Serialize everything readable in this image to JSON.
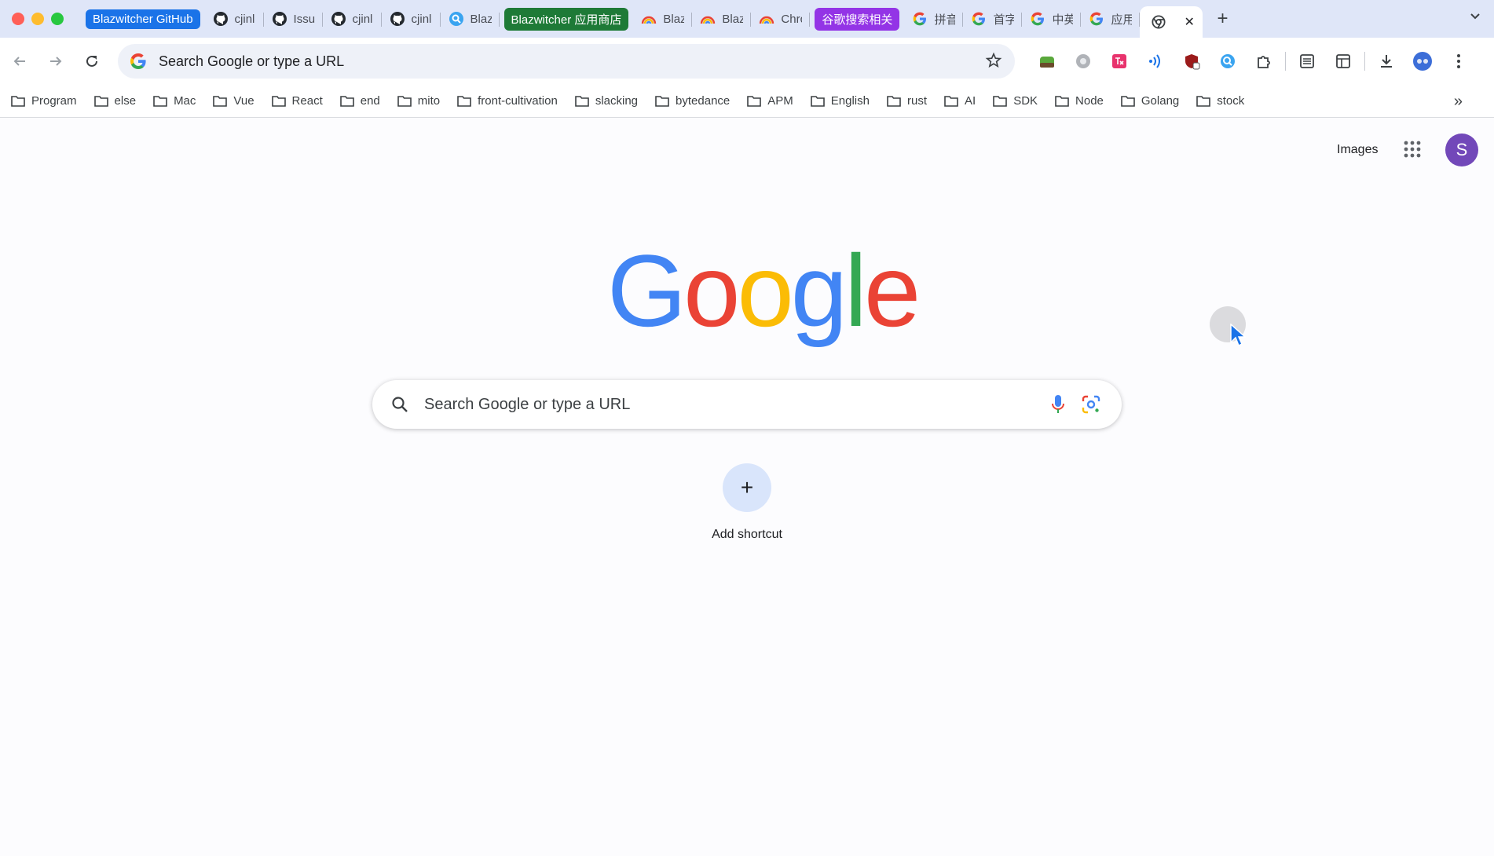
{
  "tabs": [
    {
      "kind": "group",
      "label": "Blazwitcher GitHub",
      "color": "#1a73e8"
    },
    {
      "kind": "tab",
      "icon": "github-icon",
      "label": "cjinl",
      "underline": "#1a73e8"
    },
    {
      "kind": "tab",
      "icon": "github-icon",
      "label": "Issu",
      "underline": "#1a73e8"
    },
    {
      "kind": "tab",
      "icon": "github-icon",
      "label": "cjinl",
      "underline": "#1a73e8"
    },
    {
      "kind": "tab",
      "icon": "github-icon",
      "label": "cjinl",
      "underline": "#1a73e8"
    },
    {
      "kind": "tab",
      "icon": "blazwitcher-icon",
      "label": "Blaz",
      "underline": ""
    },
    {
      "kind": "group",
      "label": "Blazwitcher 应用商店",
      "color": "#1e7a37"
    },
    {
      "kind": "tab",
      "icon": "rainbow-icon",
      "label": "Blaz",
      "underline": "#1e7a37"
    },
    {
      "kind": "tab",
      "icon": "rainbow-icon",
      "label": "Blaz",
      "underline": "#1e7a37"
    },
    {
      "kind": "tab",
      "icon": "rainbow-icon",
      "label": "Chrc",
      "underline": "#1e7a37"
    },
    {
      "kind": "group",
      "label": "谷歌搜索相关",
      "color": "#9334e6"
    },
    {
      "kind": "tab",
      "icon": "google-icon",
      "label": "拼音",
      "underline": "#9334e6"
    },
    {
      "kind": "tab",
      "icon": "google-icon",
      "label": "首字",
      "underline": "#9334e6"
    },
    {
      "kind": "tab",
      "icon": "google-icon",
      "label": "中英",
      "underline": "#9334e6"
    },
    {
      "kind": "tab",
      "icon": "google-icon",
      "label": "应用",
      "underline": "#9334e6"
    }
  ],
  "active_tab": {
    "icon": "chrome-icon",
    "close": "✕"
  },
  "new_tab_label": "+",
  "omnibox": {
    "text": "Search Google or type a URL"
  },
  "bookmarks": [
    "Program",
    "else",
    "Mac",
    "Vue",
    "React",
    "end",
    "mito",
    "front-cultivation",
    "slacking",
    "bytedance",
    "APM",
    "English",
    "rust",
    "AI",
    "SDK",
    "Node",
    "Golang",
    "stock"
  ],
  "bookmarks_more": "»",
  "header": {
    "images_label": "Images",
    "avatar_letter": "S"
  },
  "logo": {
    "letters": [
      "G",
      "o",
      "o",
      "g",
      "l",
      "e"
    ],
    "colors": [
      "#4285f4",
      "#ea4335",
      "#fbbc05",
      "#4285f4",
      "#34a853",
      "#ea4335"
    ]
  },
  "search": {
    "placeholder": "Search Google or type a URL"
  },
  "shortcut": {
    "icon": "+",
    "label": "Add shortcut"
  }
}
